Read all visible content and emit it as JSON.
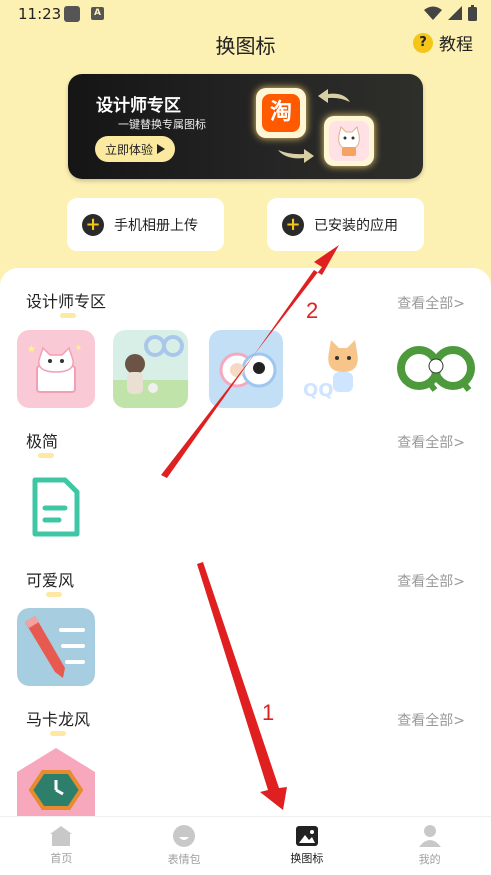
{
  "status": {
    "time": "11:23"
  },
  "header": {
    "title": "换图标",
    "tutorial_label": "教程"
  },
  "banner": {
    "title": "设计师专区",
    "subtitle": "一键替换专属图标",
    "cta_label": "立即体验",
    "tao_char": "淘"
  },
  "actions": [
    {
      "label": "手机相册上传"
    },
    {
      "label": "已安装的应用"
    }
  ],
  "sections": [
    {
      "title": "设计师专区",
      "view_all": "查看全部>"
    },
    {
      "title": "极简",
      "view_all": "查看全部>"
    },
    {
      "title": "可爱风",
      "view_all": "查看全部>"
    },
    {
      "title": "马卡龙风",
      "view_all": "查看全部>"
    }
  ],
  "tabs": [
    {
      "label": "首页",
      "icon": "home-icon"
    },
    {
      "label": "表情包",
      "icon": "emoji-icon"
    },
    {
      "label": "换图标",
      "icon": "image-icon"
    },
    {
      "label": "我的",
      "icon": "person-icon"
    }
  ],
  "annotations": [
    "1",
    "2"
  ],
  "colors": {
    "background": "#fdf0b3",
    "accent": "#f5c518",
    "annotation": "#e02020"
  }
}
